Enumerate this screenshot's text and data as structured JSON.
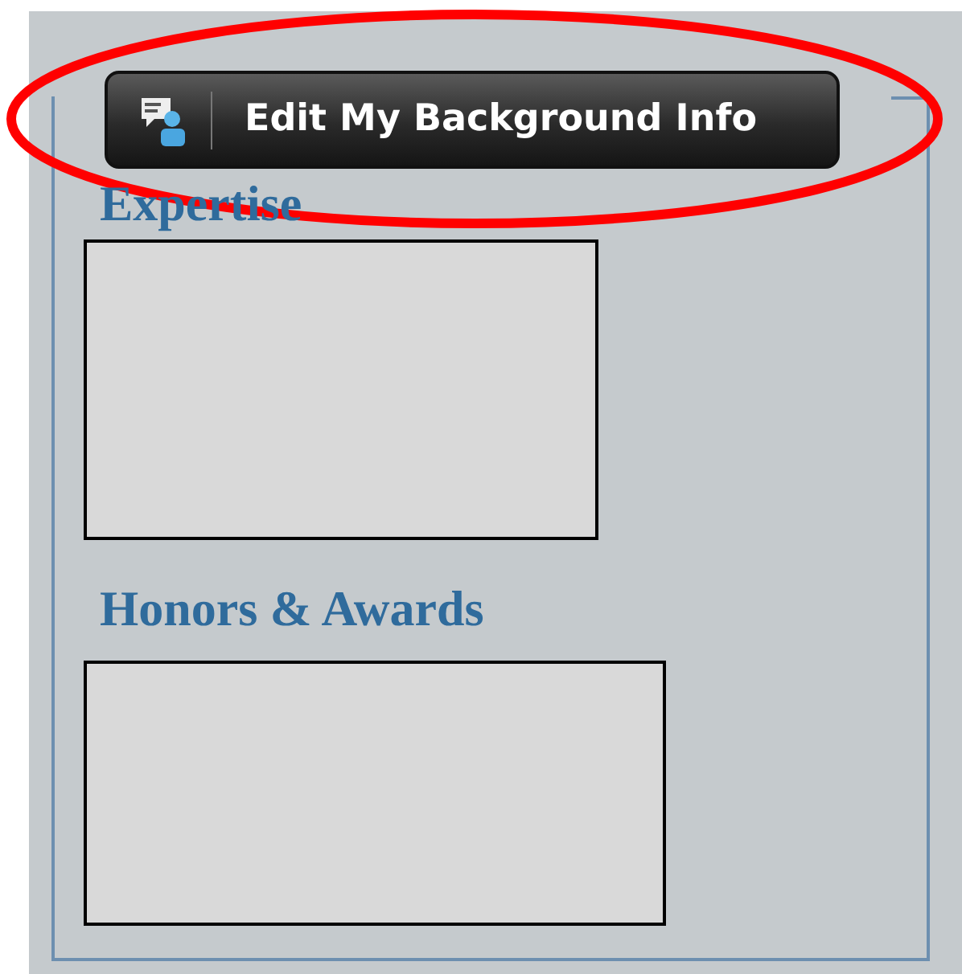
{
  "button": {
    "label": "Edit My Background Info"
  },
  "sections": [
    {
      "heading": "Expertise",
      "kind": "small"
    },
    {
      "heading": "Honors & Awards",
      "kind": "wide"
    }
  ],
  "annotation": {
    "kind": "ellipse"
  }
}
